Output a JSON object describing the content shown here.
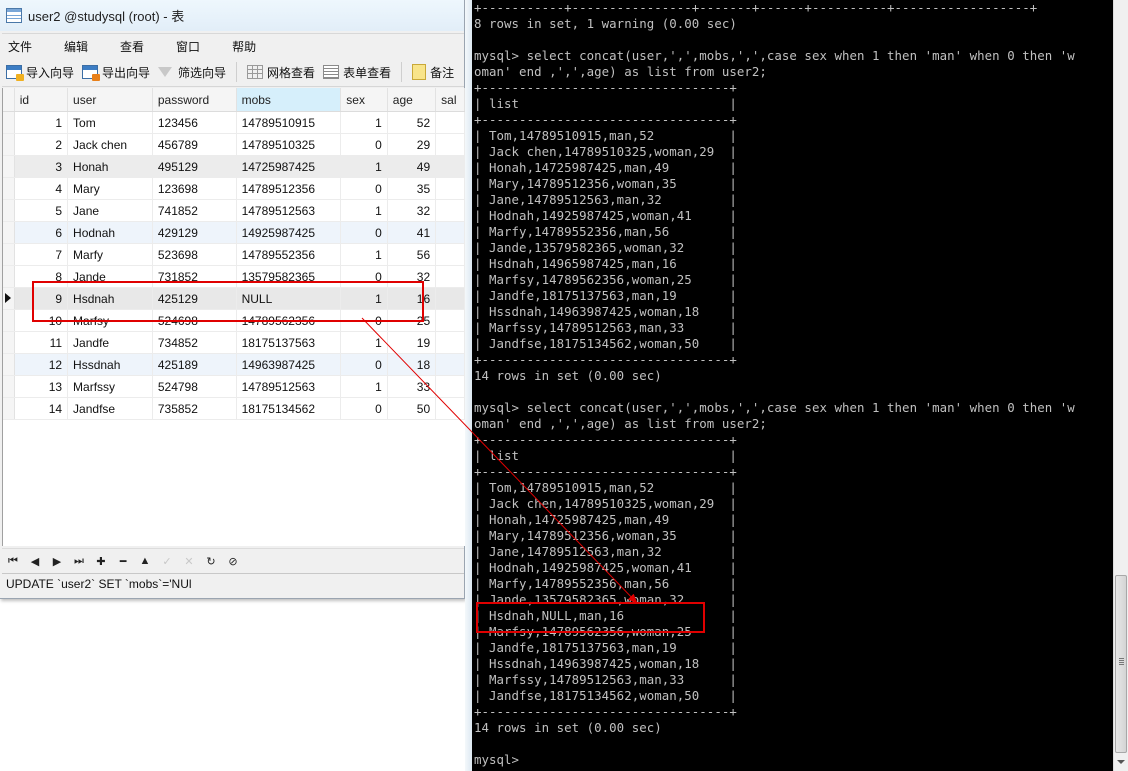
{
  "navicat": {
    "title": "user2 @studysql (root) - 表",
    "menu": [
      "文件",
      "编辑",
      "查看",
      "窗口",
      "帮助"
    ],
    "toolbar": {
      "import_wizard": "导入向导",
      "export_wizard": "导出向导",
      "filter_wizard": "筛选向导",
      "grid_view": "网格查看",
      "form_view": "表单查看",
      "memo": "备注"
    },
    "grid": {
      "columns": [
        "id",
        "user",
        "password",
        "mobs",
        "sex",
        "age",
        "sal"
      ],
      "sorted_column": "mobs",
      "selected_row": 9,
      "rows": [
        {
          "id": "1",
          "user": "Tom",
          "password": "123456",
          "mobs": "14789510915",
          "sex": "1",
          "age": "52"
        },
        {
          "id": "2",
          "user": "Jack chen",
          "password": "456789",
          "mobs": "14789510325",
          "sex": "0",
          "age": "29"
        },
        {
          "id": "3",
          "user": "Honah",
          "password": "495129",
          "mobs": "14725987425",
          "sex": "1",
          "age": "49"
        },
        {
          "id": "4",
          "user": "Mary",
          "password": "123698",
          "mobs": "14789512356",
          "sex": "0",
          "age": "35"
        },
        {
          "id": "5",
          "user": "Jane",
          "password": "741852",
          "mobs": "14789512563",
          "sex": "1",
          "age": "32"
        },
        {
          "id": "6",
          "user": "Hodnah",
          "password": "429129",
          "mobs": "14925987425",
          "sex": "0",
          "age": "41"
        },
        {
          "id": "7",
          "user": "Marfy",
          "password": "523698",
          "mobs": "14789552356",
          "sex": "1",
          "age": "56"
        },
        {
          "id": "8",
          "user": "Jande",
          "password": "731852",
          "mobs": "13579582365",
          "sex": "0",
          "age": "32"
        },
        {
          "id": "9",
          "user": "Hsdnah",
          "password": "425129",
          "mobs": "NULL",
          "sex": "1",
          "age": "16"
        },
        {
          "id": "10",
          "user": "Marfsy",
          "password": "524698",
          "mobs": "14789562356",
          "sex": "0",
          "age": "25"
        },
        {
          "id": "11",
          "user": "Jandfe",
          "password": "734852",
          "mobs": "18175137563",
          "sex": "1",
          "age": "19"
        },
        {
          "id": "12",
          "user": "Hssdnah",
          "password": "425189",
          "mobs": "14963987425",
          "sex": "0",
          "age": "18"
        },
        {
          "id": "13",
          "user": "Marfssy",
          "password": "524798",
          "mobs": "14789512563",
          "sex": "1",
          "age": "33"
        },
        {
          "id": "14",
          "user": "Jandfse",
          "password": "735852",
          "mobs": "18175134562",
          "sex": "0",
          "age": "50"
        }
      ]
    },
    "nav_buttons": [
      {
        "name": "first-record-button",
        "glyph": "⏮",
        "icon": "first-icon",
        "enabled": true
      },
      {
        "name": "prev-record-button",
        "glyph": "◀",
        "icon": "prev-icon",
        "enabled": true
      },
      {
        "name": "next-record-button",
        "glyph": "▶",
        "icon": "next-icon",
        "enabled": true
      },
      {
        "name": "last-record-button",
        "glyph": "⏭",
        "icon": "last-icon",
        "enabled": true
      },
      {
        "name": "add-record-button",
        "glyph": "✚",
        "icon": "plus-icon",
        "enabled": true
      },
      {
        "name": "delete-record-button",
        "glyph": "━",
        "icon": "minus-icon",
        "enabled": true
      },
      {
        "name": "edit-record-button",
        "glyph": "▲",
        "icon": "up-icon",
        "enabled": true
      },
      {
        "name": "apply-changes-button",
        "glyph": "✓",
        "icon": "check-icon",
        "enabled": false
      },
      {
        "name": "discard-changes-button",
        "glyph": "✕",
        "icon": "x-icon",
        "enabled": false
      },
      {
        "name": "refresh-button",
        "glyph": "↻",
        "icon": "refresh-icon",
        "enabled": true
      },
      {
        "name": "stop-button",
        "glyph": "⊘",
        "icon": "stop-icon",
        "enabled": true
      }
    ],
    "status_text": "UPDATE `user2` SET `mobs`='NUl"
  },
  "terminal": {
    "lines": [
      "+-----------+----------------+-------+------+----------+------------------+",
      "8 rows in set, 1 warning (0.00 sec)",
      "",
      "mysql> select concat(user,',',mobs,',',case sex when 1 then 'man' when 0 then 'w",
      "oman' end ,',',age) as list from user2;",
      "+---------------------------------+",
      "| list                            |",
      "+---------------------------------+",
      "| Tom,14789510915,man,52          |",
      "| Jack chen,14789510325,woman,29  |",
      "| Honah,14725987425,man,49        |",
      "| Mary,14789512356,woman,35       |",
      "| Jane,14789512563,man,32         |",
      "| Hodnah,14925987425,woman,41     |",
      "| Marfy,14789552356,man,56        |",
      "| Jande,13579582365,woman,32      |",
      "| Hsdnah,14965987425,man,16       |",
      "| Marfsy,14789562356,woman,25     |",
      "| Jandfe,18175137563,man,19       |",
      "| Hssdnah,14963987425,woman,18    |",
      "| Marfssy,14789512563,man,33      |",
      "| Jandfse,18175134562,woman,50    |",
      "+---------------------------------+",
      "14 rows in set (0.00 sec)",
      "",
      "mysql> select concat(user,',',mobs,',',case sex when 1 then 'man' when 0 then 'w",
      "oman' end ,',',age) as list from user2;",
      "+---------------------------------+",
      "| list                            |",
      "+---------------------------------+",
      "| Tom,14789510915,man,52          |",
      "| Jack chen,14789510325,woman,29  |",
      "| Honah,14725987425,man,49        |",
      "| Mary,14789512356,woman,35       |",
      "| Jane,14789512563,man,32         |",
      "| Hodnah,14925987425,woman,41     |",
      "| Marfy,14789552356,man,56        |",
      "| Jande,13579582365,woman,32      |",
      "| Hsdnah,NULL,man,16              |",
      "| Marfsy,14789562356,woman,25     |",
      "| Jandfe,18175137563,man,19       |",
      "| Hssdnah,14963987425,woman,18    |",
      "| Marfssy,14789512563,man,33      |",
      "| Jandfse,18175134562,woman,50    |",
      "+---------------------------------+",
      "14 rows in set (0.00 sec)",
      "",
      "mysql>"
    ]
  },
  "colors": {
    "annotation_red": "#e00000",
    "terminal_bg": "#000000",
    "terminal_fg": "#c0c0c0",
    "sorted_header": "#d6effb"
  }
}
